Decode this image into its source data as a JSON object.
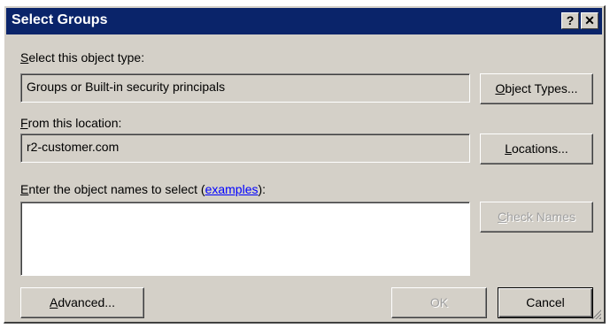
{
  "window": {
    "title": "Select Groups",
    "help_glyph": "?",
    "close_glyph": "✕"
  },
  "object_type": {
    "label_first": "S",
    "label_rest": "elect this object type:",
    "value": "Groups or Built-in security principals",
    "button_first": "O",
    "button_rest": "bject Types..."
  },
  "location": {
    "label_first": "F",
    "label_rest": "rom this location:",
    "value": "r2-customer.com",
    "button_first": "L",
    "button_rest": "ocations..."
  },
  "names": {
    "label_first": "E",
    "label_rest": "nter the object names to select (",
    "link_text": "examples",
    "label_end": "):",
    "value": "",
    "check_button_first": "C",
    "check_button_rest": "heck Names"
  },
  "footer": {
    "advanced_first": "A",
    "advanced_rest": "dvanced...",
    "ok_label": "OK",
    "cancel_label": "Cancel"
  },
  "colors": {
    "titlebar": "#0a246a",
    "dialog_bg": "#d4d0c8",
    "link": "#0000ff"
  }
}
